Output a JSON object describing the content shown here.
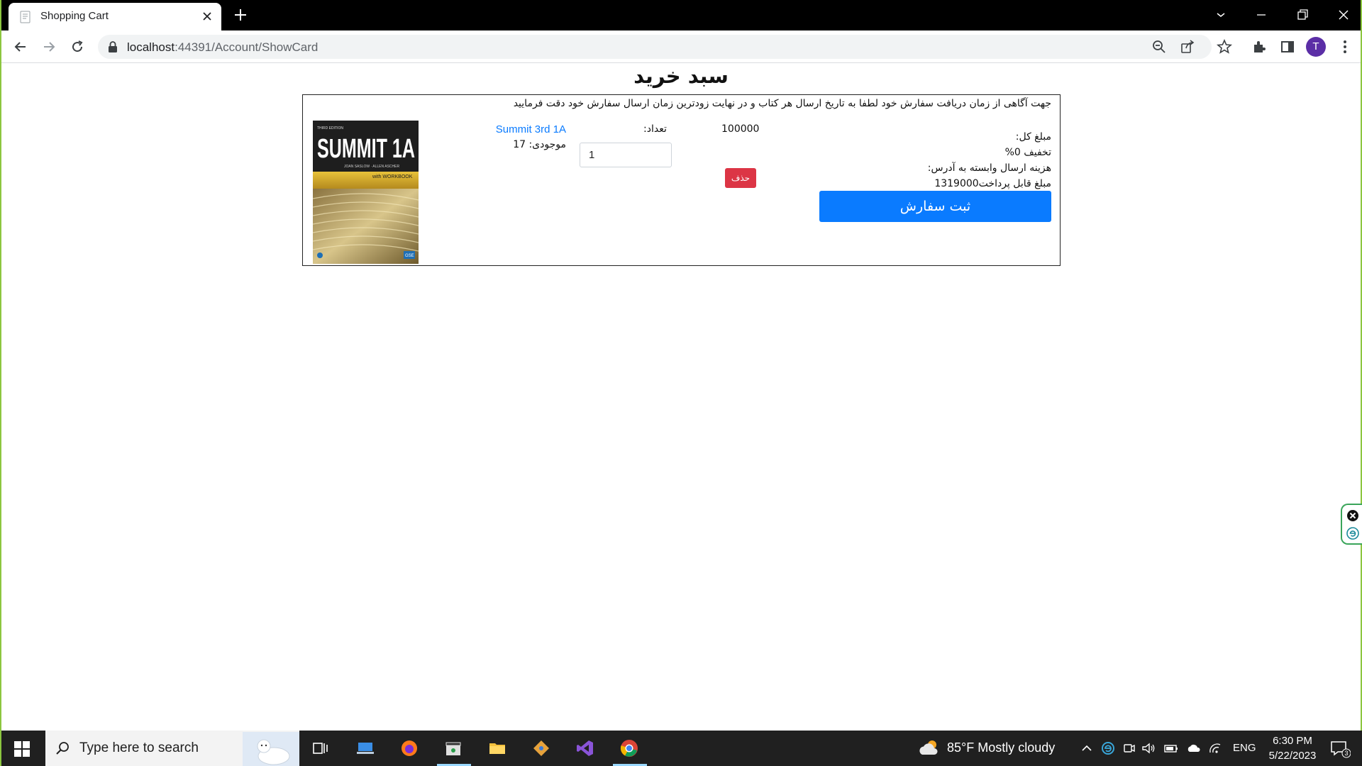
{
  "browser": {
    "tab_title": "Shopping Cart",
    "url_host": "localhost",
    "url_rest": ":44391/Account/ShowCard",
    "profile_initial": "T"
  },
  "page": {
    "title": "سبد خرید",
    "notice": "جهت آگاهی از زمان دریافت سفارش خود لطفا به تاریخ ارسال هر کتاب و در نهایت زودترین زمان ارسال سفارش خود دقت فرمایید",
    "summary": {
      "total_label": "مبلغ کل:",
      "discount": "تخفیف 0%",
      "shipping_label": "هزینه ارسال وابسته به آدرس:",
      "payable": "مبلغ قابل پرداخت1319000"
    },
    "submit_label": "ثبت سفارش",
    "item": {
      "name": "Summit 3rd 1A",
      "stock": "موجودی: 17",
      "quantity_label": ":تعداد",
      "quantity_value": "1",
      "price": "100000",
      "delete_label": "حذف",
      "cover_title": "SUMMIT 1A",
      "cover_edition": "THIRD EDITION",
      "cover_authors": "JOAN SASLOW · ALLEN ASCHER",
      "cover_workbook": "with WORKBOOK",
      "cover_badge": "GSE"
    }
  },
  "taskbar": {
    "search_placeholder": "Type here to search",
    "weather": "85°F  Mostly cloudy",
    "language": "ENG",
    "time": "6:30 PM",
    "date": "5/22/2023",
    "notification_count": "3"
  }
}
